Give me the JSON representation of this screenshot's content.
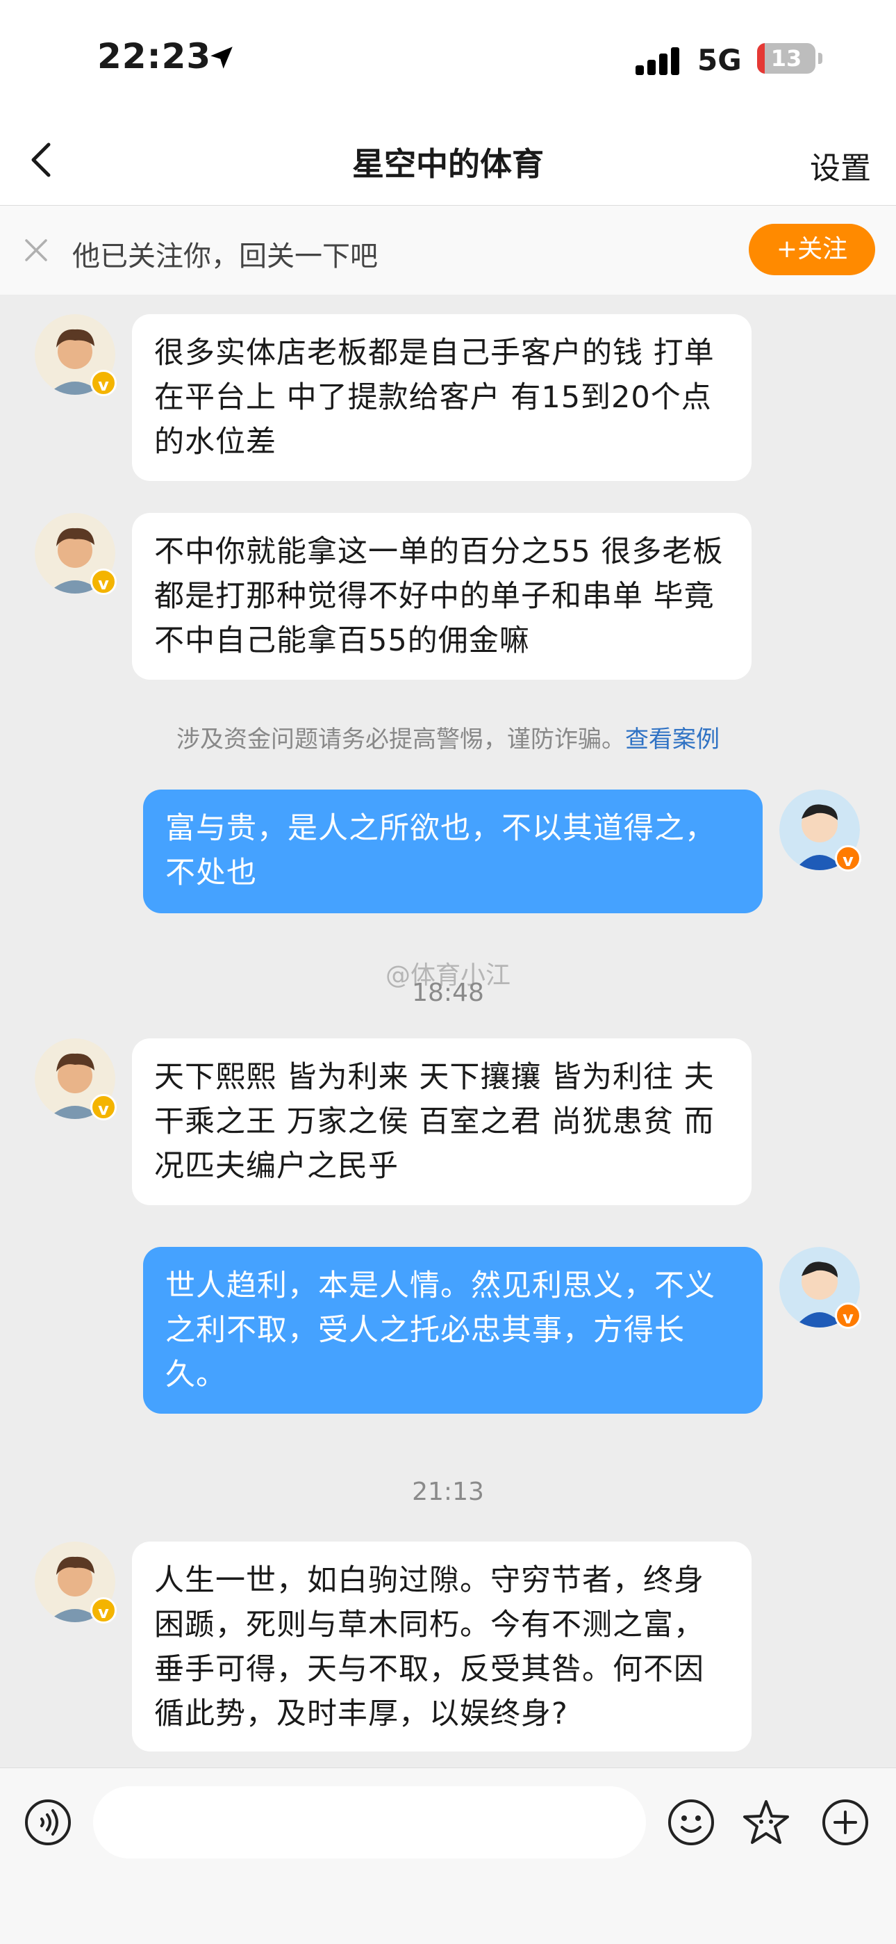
{
  "status_bar": {
    "time": "22:23",
    "network": "5G",
    "battery": "13",
    "battery_level": 0.13
  },
  "nav": {
    "title": "星空中的体育",
    "settings_label": "设置"
  },
  "follow_bar": {
    "text": "他已关注你，回关一下吧",
    "button_label": "+关注"
  },
  "messages": [
    {
      "side": "in",
      "text": "很多实体店老板都是自己手客户的钱 打单在平台上 中了提款给客户 有15到20个点的水位差"
    },
    {
      "side": "in",
      "text": "不中你就能拿这一单的百分之55 很多老板都是打那种觉得不好中的单子和串单 毕竟不中自己能拿百55的佣金嘛"
    },
    {
      "side": "out",
      "text": "富与贵，是人之所欲也，不以其道得之，不处也"
    },
    {
      "side": "in",
      "text": "天下熙熙 皆为利来 天下攘攘 皆为利往 夫干乘之王 万家之侯 百室之君 尚犹患贫 而况匹夫编户之民乎"
    },
    {
      "side": "out",
      "text": "世人趋利，本是人情。然见利思义，不义之利不取，受人之托必忠其事，方得长久。"
    },
    {
      "side": "in",
      "text": "人生一世，如白驹过隙。守穷节者，终身困踬，死则与草木同朽。今有不测之富，垂手可得，天与不取，反受其咎。何不因循此势，及时丰厚，以娱终身?"
    }
  ],
  "notice": {
    "text": "涉及资金问题请务必提高警惕，谨防诈骗。",
    "link": "查看案例"
  },
  "timestamps": [
    "18:48",
    "21:13"
  ],
  "watermark": "@体育小江",
  "input": {
    "placeholder": ""
  },
  "icons": [
    "location-arrow-icon",
    "back-arrow-icon",
    "close-icon",
    "voice-icon",
    "emoji-icon",
    "sticker-icon",
    "plus-icon"
  ],
  "colors": {
    "accent_orange": "#ff8a00",
    "outgoing_bubble": "#45a2ff",
    "link_blue": "#2f72c4",
    "background": "#ededed"
  }
}
